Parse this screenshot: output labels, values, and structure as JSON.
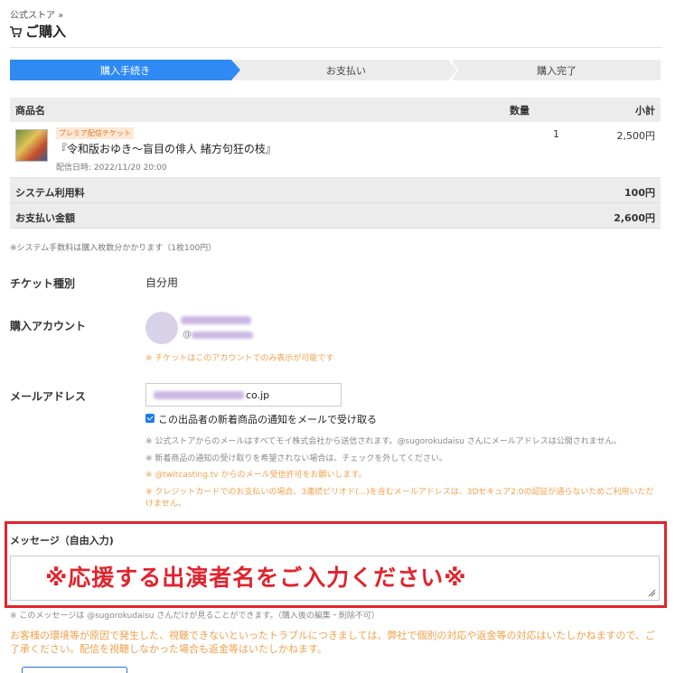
{
  "breadcrumb": "公式ストア »",
  "page_title": "ご購入",
  "steps": [
    "購入手続き",
    "お支払い",
    "購入完了"
  ],
  "colors": {
    "accent": "#2f8af3",
    "warning": "#f0a04b",
    "highlight": "#e0242d"
  },
  "cart": {
    "headers": {
      "name": "商品名",
      "qty": "数量",
      "subtotal": "小計"
    },
    "item": {
      "badge": "プレミア配信チケット",
      "name": "『令和版おゆき～盲目の俳人 緒方句狂の枝』",
      "date": "配信日時: 2022/11/20 20:00",
      "qty": "1",
      "subtotal": "2,500円"
    },
    "fee_label": "システム利用料",
    "fee_value": "100円",
    "total_label": "お支払い金額",
    "total_value": "2,600円"
  },
  "fee_note": "※システム手数料は購入枚数分かかります（1枚100円）",
  "form": {
    "ticket_type_label": "チケット種別",
    "ticket_type_value": "自分用",
    "account_label": "購入アカウント",
    "account_handle_prefix": "@",
    "account_note": "※ チケットはこのアカウントでのみ表示が可能です",
    "email_label": "メールアドレス",
    "email_suffix": "co.jp",
    "subscribe_label": "この出品者の新着商品の通知をメールで受け取る",
    "notes": [
      "※ 公式ストアからのメールはすべてモイ株式会社から送信されます。@sugorokudaisu さんにメールアドレスは公開されません。",
      "※ 新着商品の通知の受け取りを希望されない場合は、チェックを外してください。",
      "※ @twitcasting.tv からのメール受信許可をお願いします。",
      "※ クレジットカードでのお支払いの場合、3連続ピリオド(...)を含むメールアドレスは、3Dセキュア2.0の認証が通らないためご利用いただけません。"
    ],
    "message_label": "メッセージ（自由入力)",
    "message_overlay": "※応援する出演者名をご入力ください※",
    "message_note": "※ このメッセージは @sugorokudaisu さんだけが見ることができます。（購入後の編集・削除不可）"
  },
  "warning_text": "お客様の環境等が原因で発生した、視聴できないといったトラブルにつきましては、弊社で個別の対応や返金等の対応はいたしかねますので、ご了承ください。配信を視聴しなかった場合も返金等はいたしかねます。"
}
